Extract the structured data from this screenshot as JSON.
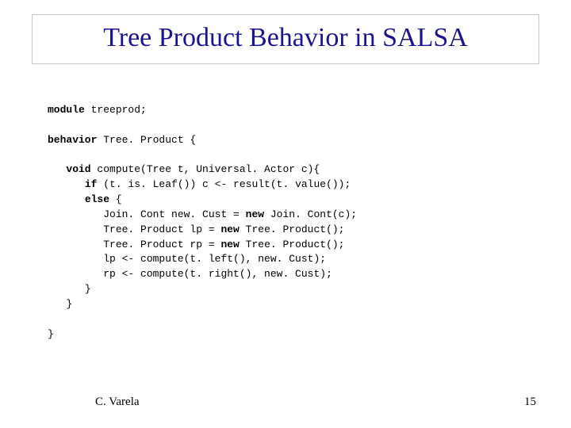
{
  "slide": {
    "title": "Tree Product Behavior in SALSA",
    "author": "C. Varela",
    "page_number": "15"
  },
  "code": {
    "kw_module": "module",
    "l1": " treeprod;",
    "kw_behavior": "behavior",
    "l2": " Tree. Product {",
    "indent1": "   ",
    "kw_void": "void",
    "l3": " compute(Tree t, Universal. Actor c){",
    "indent2": "      ",
    "kw_if": "if",
    "l4": " (t. is. Leaf()) c <- result(t. value());",
    "kw_else": "else",
    "l5": " {",
    "indent3": "         ",
    "l6": "Join. Cont new. Cust = ",
    "kw_new1": "new",
    "l6b": " Join. Cont(c);",
    "l7": "Tree. Product lp = ",
    "kw_new2": "new",
    "l7b": " Tree. Product();",
    "l8": "Tree. Product rp = ",
    "kw_new3": "new",
    "l8b": " Tree. Product();",
    "l9": "lp <- compute(t. left(), new. Cust);",
    "l10": "rp <- compute(t. right(), new. Cust);",
    "l11": "      }",
    "l12": "   }",
    "l13": "}"
  }
}
